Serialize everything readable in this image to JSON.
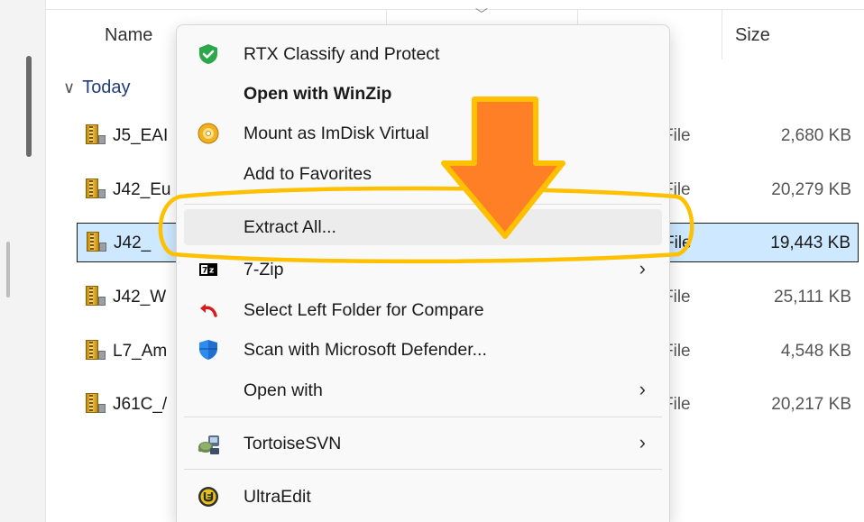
{
  "columns": {
    "name": "Name",
    "size": "Size"
  },
  "group": {
    "label": "Today",
    "chevron": "∨"
  },
  "files": [
    {
      "name": "J5_EAI",
      "type": "File",
      "size": "2,680 KB",
      "selected": false
    },
    {
      "name": "J42_Eu",
      "type": "File",
      "size": "20,279 KB",
      "selected": false
    },
    {
      "name": "J42_",
      "type": "File",
      "size": "19,443 KB",
      "selected": true
    },
    {
      "name": "J42_W",
      "type": "File",
      "size": "25,111 KB",
      "selected": false
    },
    {
      "name": "L7_Am",
      "type": "File",
      "size": "4,548 KB",
      "selected": false
    },
    {
      "name": "J61C_/",
      "type": "File",
      "size": "20,217 KB",
      "selected": false
    }
  ],
  "context_menu": {
    "items": [
      {
        "label": "RTX Classify and Protect",
        "icon": "shield-check-icon"
      },
      {
        "label": "Open with WinZip",
        "icon": "",
        "bold": true
      },
      {
        "label": "Mount as ImDisk Virtual",
        "icon": "disc-icon"
      },
      {
        "label": "Add to Favorites",
        "icon": ""
      },
      {
        "label": "Extract All...",
        "icon": "",
        "highlighted": true
      },
      {
        "label": "7-Zip",
        "icon": "sevenzip-icon",
        "submenu": true
      },
      {
        "label": "Select Left Folder for Compare",
        "icon": "compare-arrow-icon"
      },
      {
        "label": "Scan with Microsoft Defender...",
        "icon": "defender-shield-icon"
      },
      {
        "label": "Open with",
        "icon": "",
        "submenu": true
      },
      {
        "label": "TortoiseSVN",
        "icon": "tortoisesvn-icon",
        "submenu": true
      },
      {
        "label": "UltraEdit",
        "icon": "ultraedit-icon"
      }
    ],
    "submenu_arrow": "›"
  },
  "annotation": {
    "arrow_color": "#ff7f27",
    "outline_color": "#ffc000"
  }
}
